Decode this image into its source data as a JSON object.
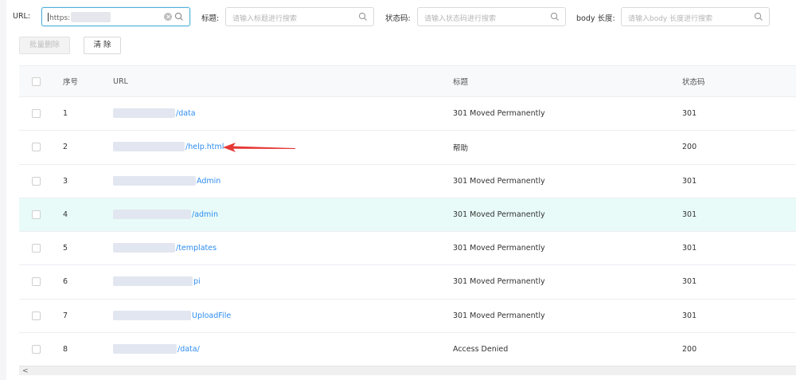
{
  "filters": {
    "url_label": "URL:",
    "url_value": "https:",
    "title_label": "标题:",
    "title_placeholder": "请输入标题进行搜索",
    "status_label": "状态码:",
    "status_placeholder": "请输入状态码进行搜索",
    "body_label": "body 长度:",
    "body_placeholder": "请输入body 长度进行搜索"
  },
  "actions": {
    "batch_delete": "批量删除",
    "clear": "清 除"
  },
  "table": {
    "headers": {
      "index": "序号",
      "url": "URL",
      "title": "标题",
      "status": "状态码"
    },
    "rows": [
      {
        "index": "1",
        "url": "/data",
        "title": "301 Moved Permanently",
        "status": "301"
      },
      {
        "index": "2",
        "url": "/help.html",
        "title": "帮助",
        "status": "200"
      },
      {
        "index": "3",
        "url": "Admin",
        "title": "301 Moved Permanently",
        "status": "301"
      },
      {
        "index": "4",
        "url": "/admin",
        "title": "301 Moved Permanently",
        "status": "301"
      },
      {
        "index": "5",
        "url": "/templates",
        "title": "301 Moved Permanently",
        "status": "301"
      },
      {
        "index": "6",
        "url": "pi",
        "title": "301 Moved Permanently",
        "status": "301"
      },
      {
        "index": "7",
        "url": "UploadFile",
        "title": "301 Moved Permanently",
        "status": "301"
      },
      {
        "index": "8",
        "url": "/data/",
        "title": "Access Denied",
        "status": "200"
      }
    ],
    "highlighted_row": 4
  },
  "scrollbar": {
    "left_arrow": "<"
  },
  "colors": {
    "link": "#2d8cf0",
    "highlight_row": "#e8fbf8",
    "focus_border": "#52b1d9",
    "annotation_arrow": "#e53935"
  }
}
